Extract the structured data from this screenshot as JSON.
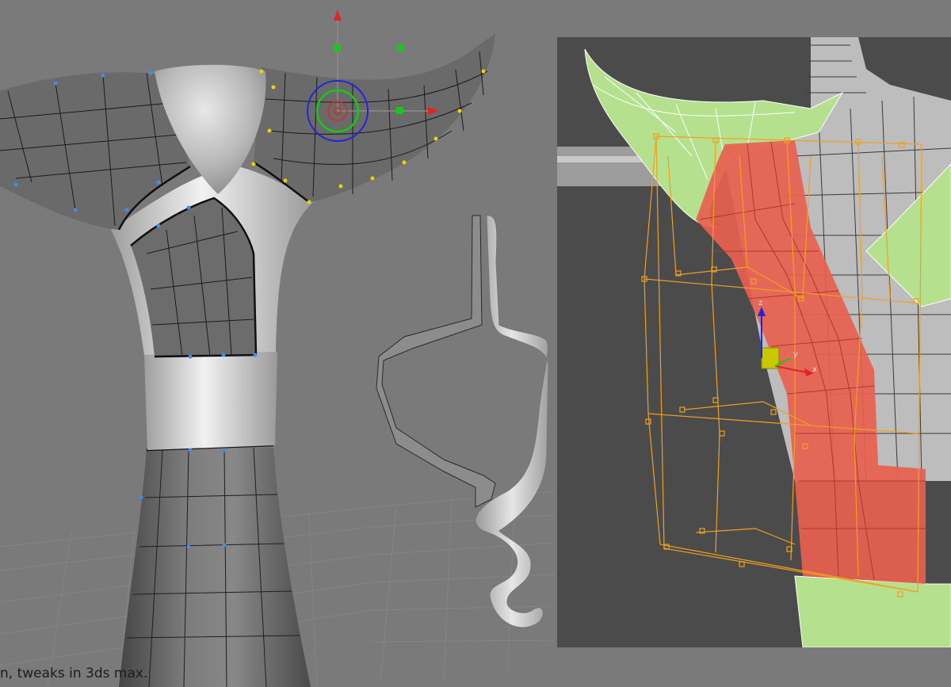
{
  "caption": "n, tweaks in 3ds max.",
  "gizmo_labels": {
    "x": "x",
    "y": "y",
    "z": "z"
  },
  "colors": {
    "viewport_bg": "#7a7a7a",
    "inset_bg": "#4b4b4b",
    "mesh_gray": "#6d6d6d",
    "mesh_light": "#d9d9d9",
    "selection_red": "#e8604f",
    "highlight_green": "#b5e08e",
    "lattice_orange": "#f0a020",
    "vertex_blue": "#3f8fe8",
    "vertex_yellow": "#e8d400",
    "gizmo_red": "#e02424",
    "gizmo_green": "#18c818",
    "gizmo_blue": "#2424d8"
  },
  "icons": [
    "move-gizmo-icon",
    "rotate-gizmo-icon",
    "axis-tripod-icon"
  ]
}
